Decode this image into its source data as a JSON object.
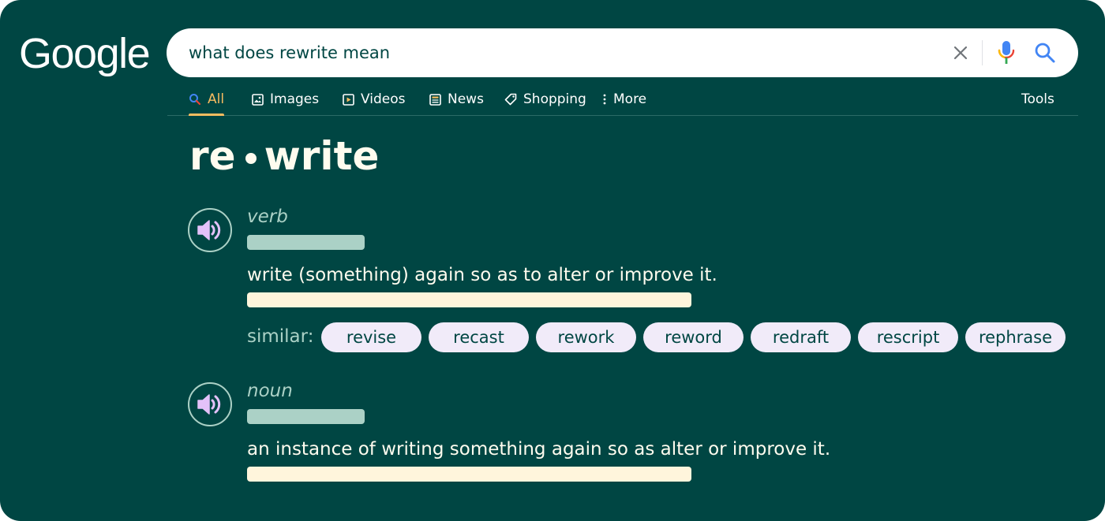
{
  "logo": {
    "text": "Google"
  },
  "search": {
    "query": "what does rewrite mean"
  },
  "tabs": [
    {
      "label": "All",
      "icon": "search-icon",
      "active": true
    },
    {
      "label": "Images",
      "icon": "image-icon"
    },
    {
      "label": "Videos",
      "icon": "play-icon"
    },
    {
      "label": "News",
      "icon": "newspaper-icon"
    },
    {
      "label": "Shopping",
      "icon": "tag-icon"
    },
    {
      "label": "More",
      "icon": "more-vertical-icon"
    }
  ],
  "tools_label": "Tools",
  "headword": {
    "part1": "re",
    "part2": "write"
  },
  "senses": [
    {
      "part_of_speech": "verb",
      "definition": "write (something) again so as to alter or improve it.",
      "similar_label": "similar:",
      "similar": [
        "revise",
        "recast",
        "rework",
        "reword",
        "redraft",
        "rescript",
        "rephrase"
      ]
    },
    {
      "part_of_speech": "noun",
      "definition": "an instance of writing something again so as alter or improve it."
    }
  ],
  "colors": {
    "background": "#004643",
    "accent": "#f9bc60",
    "text_light": "#fffcef",
    "muted": "#abd1c6",
    "chip_bg": "#f1ebf9",
    "speaker_icon": "#e4c1f9"
  }
}
